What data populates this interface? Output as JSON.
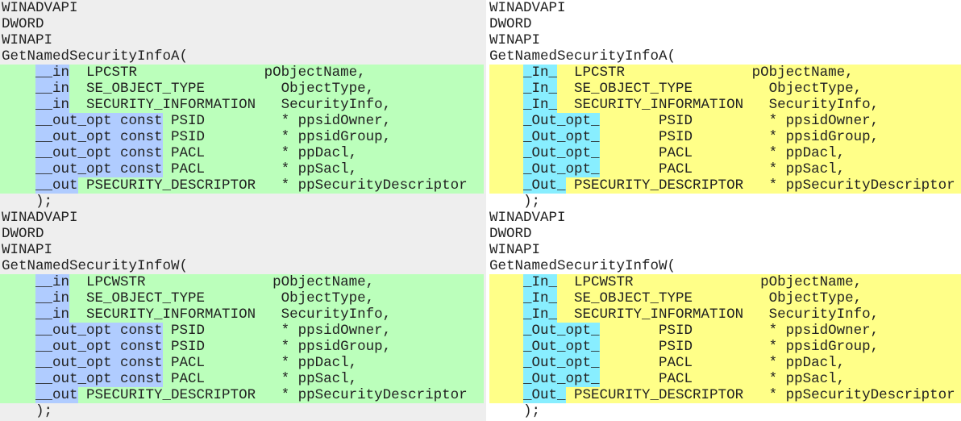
{
  "colors": {
    "left_background": "#eeeeee",
    "left_param_row": "#bbffbb",
    "left_annotation": "#b0ccff",
    "right_background": "#ffffff",
    "right_param_row": "#ffff88",
    "right_annotation": "#88eeff"
  },
  "left_panel": {
    "annotation_style": "legacy SAL (__in / __out)",
    "blocks": [
      {
        "header": [
          "WINADVAPI",
          "DWORD",
          "WINAPI",
          "GetNamedSecurityInfoA("
        ],
        "params": [
          [
            {
              "hl": true,
              "t": "__in"
            },
            {
              "t": "  LPCSTR               pObjectName,"
            }
          ],
          [
            {
              "hl": true,
              "t": "__in"
            },
            {
              "t": "  SE_OBJECT_TYPE         ObjectType,"
            }
          ],
          [
            {
              "hl": true,
              "t": "__in"
            },
            {
              "t": "  SECURITY_INFORMATION   SecurityInfo,"
            }
          ],
          [
            {
              "hl": true,
              "t": "__out_opt const"
            },
            {
              "t": " PSID         * ppsidOwner,"
            }
          ],
          [
            {
              "hl": true,
              "t": "__out_opt const"
            },
            {
              "t": " PSID         * ppsidGroup,"
            }
          ],
          [
            {
              "hl": true,
              "t": "__out_opt const"
            },
            {
              "t": " PACL         * ppDacl,"
            }
          ],
          [
            {
              "hl": true,
              "t": "__out_opt const"
            },
            {
              "t": " PACL         * ppSacl,"
            }
          ],
          [
            {
              "hl": true,
              "t": "__out"
            },
            {
              "t": " PSECURITY_DESCRIPTOR   * ppSecurityDescriptor"
            }
          ]
        ],
        "footer": "    );"
      },
      {
        "header": [
          "WINADVAPI",
          "DWORD",
          "WINAPI",
          "GetNamedSecurityInfoW("
        ],
        "params": [
          [
            {
              "hl": true,
              "t": "__in"
            },
            {
              "t": "  LPCWSTR               pObjectName,"
            }
          ],
          [
            {
              "hl": true,
              "t": "__in"
            },
            {
              "t": "  SE_OBJECT_TYPE         ObjectType,"
            }
          ],
          [
            {
              "hl": true,
              "t": "__in"
            },
            {
              "t": "  SECURITY_INFORMATION   SecurityInfo,"
            }
          ],
          [
            {
              "hl": true,
              "t": "__out_opt const"
            },
            {
              "t": " PSID         * ppsidOwner,"
            }
          ],
          [
            {
              "hl": true,
              "t": "__out_opt const"
            },
            {
              "t": " PSID         * ppsidGroup,"
            }
          ],
          [
            {
              "hl": true,
              "t": "__out_opt const"
            },
            {
              "t": " PACL         * ppDacl,"
            }
          ],
          [
            {
              "hl": true,
              "t": "__out_opt const"
            },
            {
              "t": " PACL         * ppSacl,"
            }
          ],
          [
            {
              "hl": true,
              "t": "__out"
            },
            {
              "t": " PSECURITY_DESCRIPTOR   * ppSecurityDescriptor"
            }
          ]
        ],
        "footer": "    );"
      }
    ]
  },
  "right_panel": {
    "annotation_style": "SAL 2.0 (_In_ / _Out_)",
    "blocks": [
      {
        "header": [
          "WINADVAPI",
          "DWORD",
          "WINAPI",
          "GetNamedSecurityInfoA("
        ],
        "params": [
          [
            {
              "hl": true,
              "t": "_In_"
            },
            {
              "t": "  LPCSTR               pObjectName,"
            }
          ],
          [
            {
              "hl": true,
              "t": "_In_"
            },
            {
              "t": "  SE_OBJECT_TYPE         ObjectType,"
            }
          ],
          [
            {
              "hl": true,
              "t": "_In_"
            },
            {
              "t": "  SECURITY_INFORMATION   SecurityInfo,"
            }
          ],
          [
            {
              "hl": true,
              "t": "_Out_opt_"
            },
            {
              "t": "       PSID         * ppsidOwner,"
            }
          ],
          [
            {
              "hl": true,
              "t": "_Out_opt_"
            },
            {
              "t": "       PSID         * ppsidGroup,"
            }
          ],
          [
            {
              "hl": true,
              "t": "_Out_opt_"
            },
            {
              "t": "       PACL         * ppDacl,"
            }
          ],
          [
            {
              "hl": true,
              "t": "_Out_opt_"
            },
            {
              "t": "       PACL         * ppSacl,"
            }
          ],
          [
            {
              "hl": true,
              "t": "_Out_"
            },
            {
              "t": " PSECURITY_DESCRIPTOR   * ppSecurityDescriptor"
            }
          ]
        ],
        "footer": "    );"
      },
      {
        "header": [
          "WINADVAPI",
          "DWORD",
          "WINAPI",
          "GetNamedSecurityInfoW("
        ],
        "params": [
          [
            {
              "hl": true,
              "t": "_In_"
            },
            {
              "t": "  LPCWSTR               pObjectName,"
            }
          ],
          [
            {
              "hl": true,
              "t": "_In_"
            },
            {
              "t": "  SE_OBJECT_TYPE         ObjectType,"
            }
          ],
          [
            {
              "hl": true,
              "t": "_In_"
            },
            {
              "t": "  SECURITY_INFORMATION   SecurityInfo,"
            }
          ],
          [
            {
              "hl": true,
              "t": "_Out_opt_"
            },
            {
              "t": "       PSID         * ppsidOwner,"
            }
          ],
          [
            {
              "hl": true,
              "t": "_Out_opt_"
            },
            {
              "t": "       PSID         * ppsidGroup,"
            }
          ],
          [
            {
              "hl": true,
              "t": "_Out_opt_"
            },
            {
              "t": "       PACL         * ppDacl,"
            }
          ],
          [
            {
              "hl": true,
              "t": "_Out_opt_"
            },
            {
              "t": "       PACL         * ppSacl,"
            }
          ],
          [
            {
              "hl": true,
              "t": "_Out_"
            },
            {
              "t": " PSECURITY_DESCRIPTOR   * ppSecurityDescriptor"
            }
          ]
        ],
        "footer": "    );"
      }
    ]
  }
}
